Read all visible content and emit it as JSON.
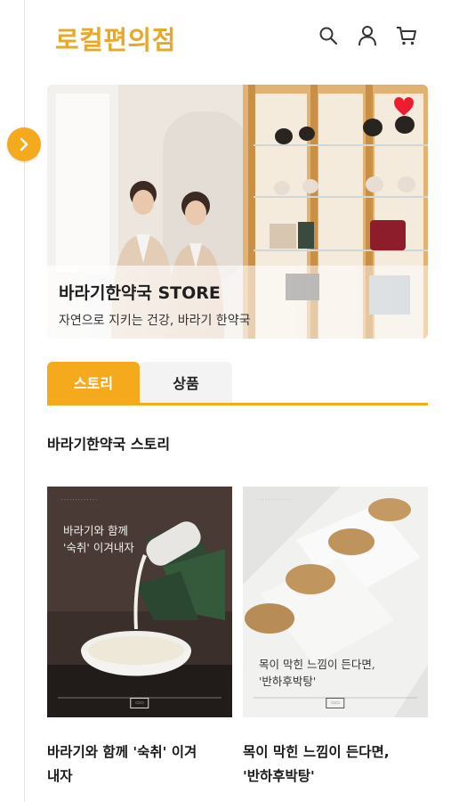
{
  "header": {
    "logo": "로컬편의점",
    "icons": [
      "search-icon",
      "user-icon",
      "cart-icon"
    ]
  },
  "hero": {
    "title": "바라기한약국 STORE",
    "subtitle": "자연으로 지키는 건강, 바라기 한약국"
  },
  "tabs": [
    {
      "label": "스토리",
      "active": true
    },
    {
      "label": "상품",
      "active": false
    }
  ],
  "section": {
    "title": "바라기한약국 스토리"
  },
  "cards": [
    {
      "thumb_text_1": "바라기와 함께",
      "thumb_text_2": "'숙취' 이겨내자",
      "caption_1": "바라기와 함께 '숙취' 이겨",
      "caption_2": "내자"
    },
    {
      "thumb_text_1": "목이 막힌 느낌이 든다면,",
      "thumb_text_2": "'반하후박탕'",
      "caption_1": "목이 막힌 느낌이 든다면,",
      "caption_2": "'반하후박탕'"
    }
  ],
  "colors": {
    "accent": "#f5a91c",
    "logo": "#e6a928"
  }
}
